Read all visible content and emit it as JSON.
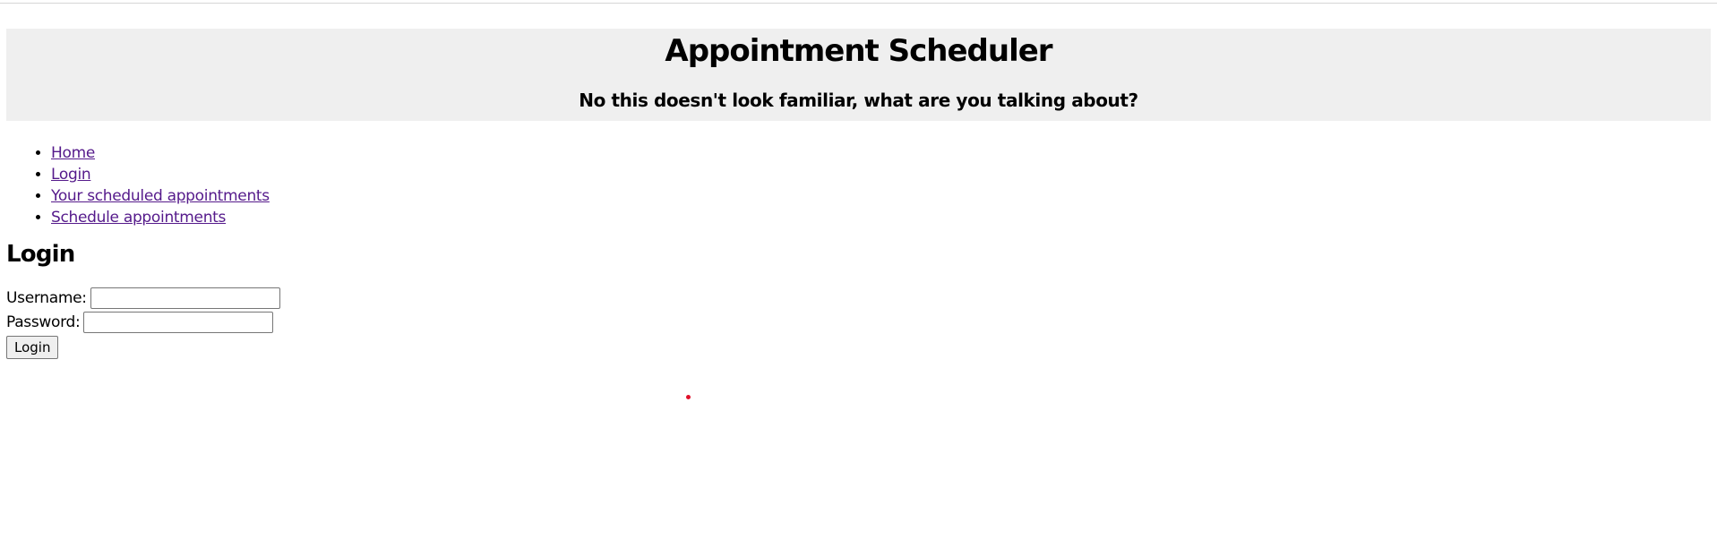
{
  "header": {
    "title": "Appointment Scheduler",
    "subtitle": "No this doesn't look familiar, what are you talking about?"
  },
  "nav": {
    "items": [
      {
        "label": "Home"
      },
      {
        "label": "Login"
      },
      {
        "label": "Your scheduled appointments"
      },
      {
        "label": "Schedule appointments"
      }
    ]
  },
  "login": {
    "title": "Login",
    "username_label": "Username:",
    "username_value": "",
    "password_label": "Password:",
    "password_value": "",
    "submit_label": "Login"
  },
  "colors": {
    "header_background": "#efefef",
    "visited_link": "#551a8b",
    "pointer_dot": "#e0102a"
  }
}
